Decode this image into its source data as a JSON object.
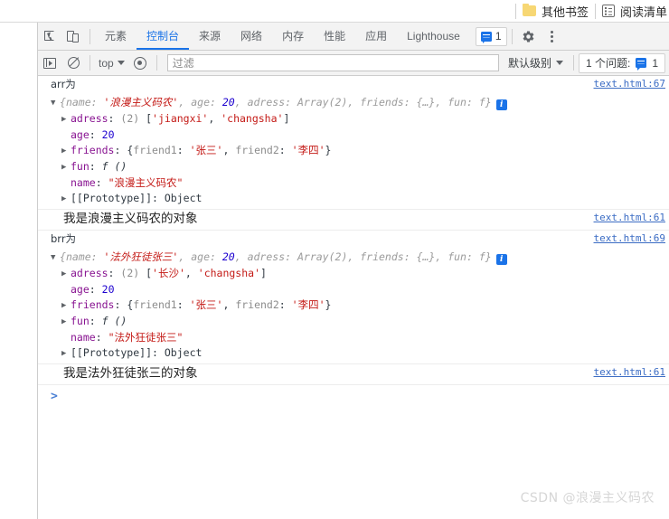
{
  "browser": {
    "bookmarks": [
      {
        "label": "其他书签",
        "icon": "folder-icon"
      },
      {
        "label": "阅读清单",
        "icon": "reading-list-icon"
      }
    ]
  },
  "devtools": {
    "toolbar": {
      "inspect_icon": "inspect-element-icon",
      "device_icon": "device-toolbar-icon",
      "tabs": [
        {
          "label": "元素",
          "active": false
        },
        {
          "label": "控制台",
          "active": true
        },
        {
          "label": "来源",
          "active": false
        },
        {
          "label": "网络",
          "active": false
        },
        {
          "label": "内存",
          "active": false
        },
        {
          "label": "性能",
          "active": false
        },
        {
          "label": "应用",
          "active": false
        },
        {
          "label": "Lighthouse",
          "active": false
        }
      ],
      "issues_count": "1",
      "settings_icon": "gear-icon",
      "more_icon": "kebab-menu-icon"
    },
    "filterbar": {
      "sidebar_icon": "console-sidebar-icon",
      "clear_icon": "clear-console-icon",
      "context": "top",
      "eye_icon": "live-expression-icon",
      "filter_placeholder": "过滤",
      "filter_value": "",
      "level": "默认级别",
      "issues_label": "1 个问题:",
      "issues_badge": "1"
    },
    "console": {
      "messages": [
        {
          "id": "msg-arr-label",
          "kind": "text",
          "text": "arr为",
          "source": "text.html:67"
        },
        {
          "id": "msg-arr-object",
          "kind": "object",
          "preview": {
            "open": "{",
            "entries": [
              {
                "key": "name",
                "sep": ": ",
                "value": "'浪漫主义码农'",
                "type": "string"
              },
              {
                "key": "age",
                "sep": ": ",
                "value": "20",
                "type": "number"
              },
              {
                "key": "adress",
                "sep": ": ",
                "value": "Array(2)",
                "type": "plain"
              },
              {
                "key": "friends",
                "sep": ": ",
                "value": "{…}",
                "type": "plain"
              },
              {
                "key": "fun",
                "sep": ": ",
                "value": "f",
                "type": "fn"
              }
            ],
            "close": "}"
          },
          "properties": [
            {
              "expandable": true,
              "key": "adress",
              "value_parts": [
                {
                  "t": "grey",
                  "s": "(2) "
                },
                {
                  "t": "punc",
                  "s": "["
                },
                {
                  "t": "str",
                  "s": "'jiangxi'"
                },
                {
                  "t": "punc",
                  "s": ", "
                },
                {
                  "t": "str",
                  "s": "'changsha'"
                },
                {
                  "t": "punc",
                  "s": "]"
                }
              ]
            },
            {
              "expandable": false,
              "key": "age",
              "value_parts": [
                {
                  "t": "num",
                  "s": "20"
                }
              ]
            },
            {
              "expandable": true,
              "key": "friends",
              "value_parts": [
                {
                  "t": "punc",
                  "s": "{"
                },
                {
                  "t": "grey",
                  "s": "friend1"
                },
                {
                  "t": "punc",
                  "s": ": "
                },
                {
                  "t": "str",
                  "s": "'张三'"
                },
                {
                  "t": "punc",
                  "s": ", "
                },
                {
                  "t": "grey",
                  "s": "friend2"
                },
                {
                  "t": "punc",
                  "s": ": "
                },
                {
                  "t": "str",
                  "s": "'李四'"
                },
                {
                  "t": "punc",
                  "s": "}"
                }
              ]
            },
            {
              "expandable": true,
              "key": "fun",
              "value_parts": [
                {
                  "t": "fnv",
                  "s": "f ()"
                }
              ]
            },
            {
              "expandable": false,
              "key": "name",
              "value_parts": [
                {
                  "t": "str",
                  "s": "\"浪漫主义码农\""
                }
              ]
            },
            {
              "expandable": true,
              "key": "[[Prototype]]",
              "proto": true,
              "value_parts": [
                {
                  "t": "proto",
                  "s": "Object"
                }
              ]
            }
          ]
        },
        {
          "id": "msg-arr-text",
          "kind": "plain",
          "text": "我是浪漫主义码农的对象",
          "source": "text.html:61"
        },
        {
          "id": "msg-brr-label",
          "kind": "text",
          "text": "brr为",
          "source": "text.html:69"
        },
        {
          "id": "msg-brr-object",
          "kind": "object",
          "preview": {
            "open": "{",
            "entries": [
              {
                "key": "name",
                "sep": ": ",
                "value": "'法外狂徒张三'",
                "type": "string"
              },
              {
                "key": "age",
                "sep": ": ",
                "value": "20",
                "type": "number"
              },
              {
                "key": "adress",
                "sep": ": ",
                "value": "Array(2)",
                "type": "plain"
              },
              {
                "key": "friends",
                "sep": ": ",
                "value": "{…}",
                "type": "plain"
              },
              {
                "key": "fun",
                "sep": ": ",
                "value": "f",
                "type": "fn"
              }
            ],
            "close": "}"
          },
          "properties": [
            {
              "expandable": true,
              "key": "adress",
              "value_parts": [
                {
                  "t": "grey",
                  "s": "(2) "
                },
                {
                  "t": "punc",
                  "s": "["
                },
                {
                  "t": "str",
                  "s": "'长沙'"
                },
                {
                  "t": "punc",
                  "s": ", "
                },
                {
                  "t": "str",
                  "s": "'changsha'"
                },
                {
                  "t": "punc",
                  "s": "]"
                }
              ]
            },
            {
              "expandable": false,
              "key": "age",
              "value_parts": [
                {
                  "t": "num",
                  "s": "20"
                }
              ]
            },
            {
              "expandable": true,
              "key": "friends",
              "value_parts": [
                {
                  "t": "punc",
                  "s": "{"
                },
                {
                  "t": "grey",
                  "s": "friend1"
                },
                {
                  "t": "punc",
                  "s": ": "
                },
                {
                  "t": "str",
                  "s": "'张三'"
                },
                {
                  "t": "punc",
                  "s": ", "
                },
                {
                  "t": "grey",
                  "s": "friend2"
                },
                {
                  "t": "punc",
                  "s": ": "
                },
                {
                  "t": "str",
                  "s": "'李四'"
                },
                {
                  "t": "punc",
                  "s": "}"
                }
              ]
            },
            {
              "expandable": true,
              "key": "fun",
              "value_parts": [
                {
                  "t": "fnv",
                  "s": "f ()"
                }
              ]
            },
            {
              "expandable": false,
              "key": "name",
              "value_parts": [
                {
                  "t": "str",
                  "s": "\"法外狂徒张三\""
                }
              ]
            },
            {
              "expandable": true,
              "key": "[[Prototype]]",
              "proto": true,
              "value_parts": [
                {
                  "t": "proto",
                  "s": "Object"
                }
              ]
            }
          ]
        },
        {
          "id": "msg-brr-text",
          "kind": "plain",
          "text": "我是法外狂徒张三的对象",
          "source": "text.html:61"
        }
      ],
      "prompt_caret": ">"
    }
  },
  "watermark": "CSDN @浪漫主义码农",
  "colors": {
    "accent": "#1a73e8",
    "key": "#881391",
    "string": "#c41a16",
    "number": "#1c00cf",
    "link": "#3b6cc4",
    "toolbar_bg": "#f3f3f3"
  }
}
